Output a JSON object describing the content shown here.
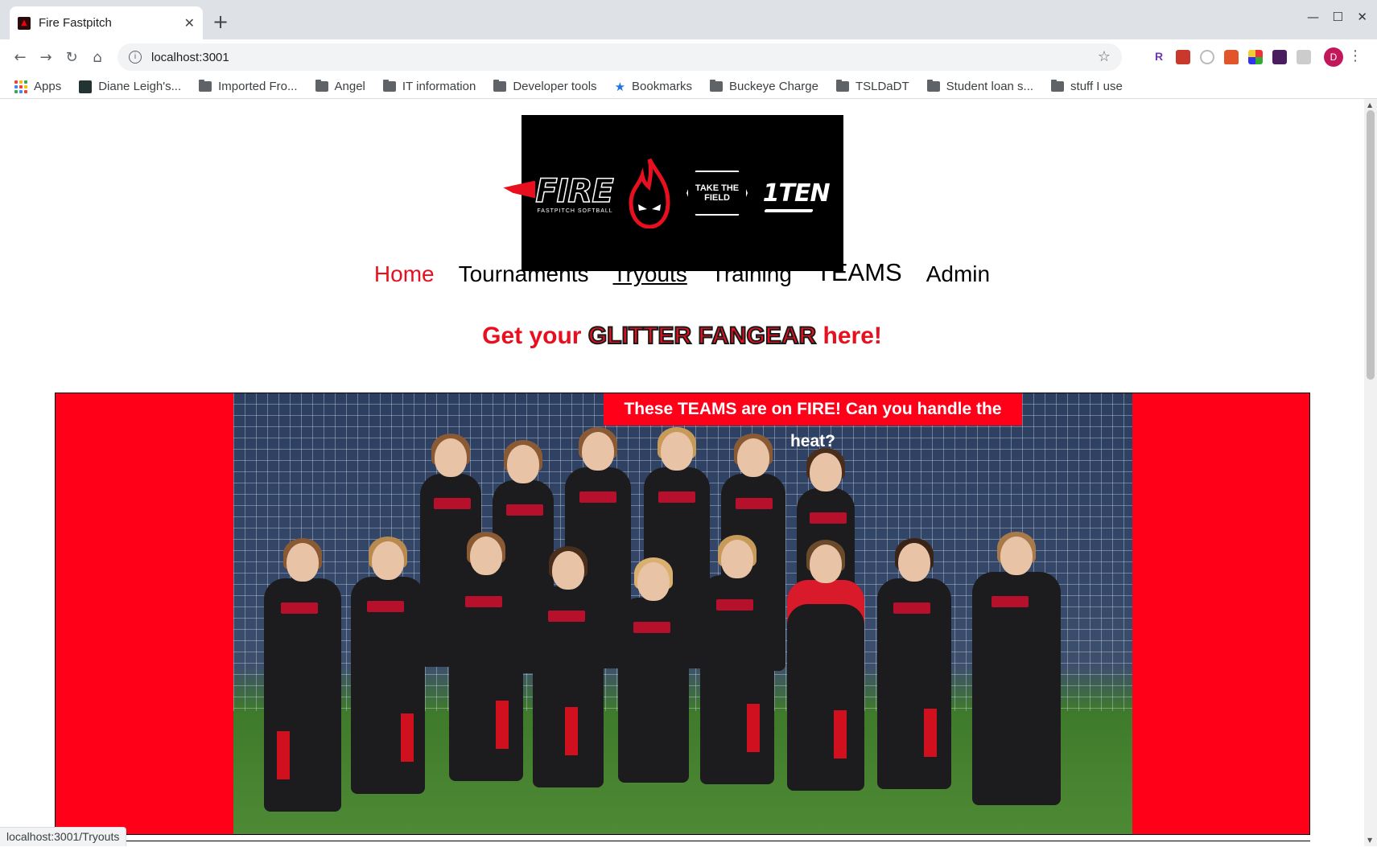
{
  "browser": {
    "tab_title": "Fire Fastpitch",
    "url": "localhost:3001",
    "profile_initial": "D",
    "bookmarks": [
      {
        "label": "Apps",
        "type": "apps"
      },
      {
        "label": "Diane Leigh's...",
        "type": "site"
      },
      {
        "label": "Imported Fro...",
        "type": "folder"
      },
      {
        "label": "Angel",
        "type": "folder"
      },
      {
        "label": "IT information",
        "type": "folder"
      },
      {
        "label": "Developer tools",
        "type": "folder"
      },
      {
        "label": "Bookmarks",
        "type": "star"
      },
      {
        "label": "Buckeye Charge",
        "type": "folder"
      },
      {
        "label": "TSLDaDT",
        "type": "folder"
      },
      {
        "label": "Student loan s...",
        "type": "folder"
      },
      {
        "label": "stuff I use",
        "type": "folder"
      }
    ],
    "status_url": "localhost:3001/Tryouts"
  },
  "site": {
    "logo": {
      "fire_word": "FIRE",
      "fire_sub": "FASTPITCH SOFTBALL",
      "badge": "TAKE THE FIELD",
      "ten": "1TEN"
    },
    "nav": [
      {
        "label": "Home",
        "state": "active"
      },
      {
        "label": "Tournaments",
        "state": "normal"
      },
      {
        "label": "Tryouts",
        "state": "hover"
      },
      {
        "label": "Training",
        "state": "normal"
      },
      {
        "label": "TEAMS",
        "state": "big"
      },
      {
        "label": "Admin",
        "state": "normal"
      }
    ],
    "promo": {
      "prefix": "Get your ",
      "highlight": "GLITTER FANGEAR",
      "suffix": " here!"
    },
    "hero_caption": "These TEAMS are on FIRE! Can you handle the heat?"
  },
  "colors": {
    "brand_red": "#ff0018",
    "active_nav": "#e8101e"
  }
}
